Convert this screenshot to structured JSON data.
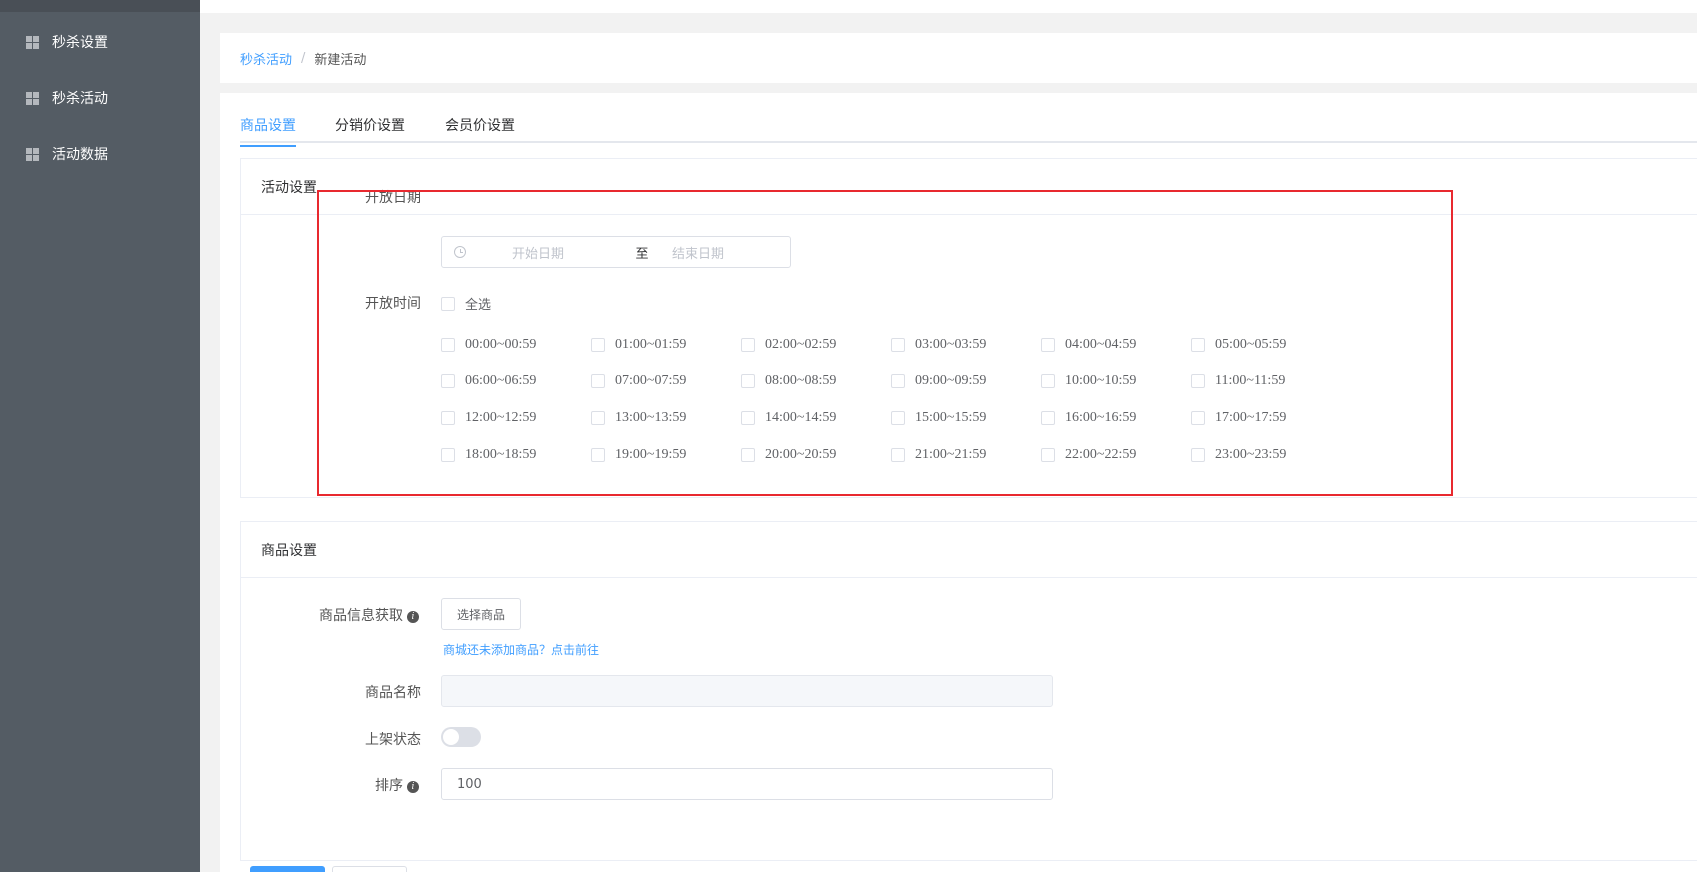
{
  "sidebar": {
    "items": [
      {
        "label": "秒杀设置",
        "icon": "grid-icon"
      },
      {
        "label": "秒杀活动",
        "icon": "grid-icon"
      },
      {
        "label": "活动数据",
        "icon": "grid-icon"
      }
    ]
  },
  "breadcrumb": {
    "parent": "秒杀活动",
    "separator": "/",
    "current": "新建活动"
  },
  "tabs": [
    {
      "label": "商品设置",
      "active": true
    },
    {
      "label": "分销价设置",
      "active": false
    },
    {
      "label": "会员价设置",
      "active": false
    }
  ],
  "activity": {
    "title": "活动设置",
    "date_label": "开放日期",
    "start_placeholder": "开始日期",
    "range_sep": "至",
    "end_placeholder": "结束日期",
    "time_label": "开放时间",
    "select_all": "全选",
    "slots": [
      "00:00~00:59",
      "01:00~01:59",
      "02:00~02:59",
      "03:00~03:59",
      "04:00~04:59",
      "05:00~05:59",
      "06:00~06:59",
      "07:00~07:59",
      "08:00~08:59",
      "09:00~09:59",
      "10:00~10:59",
      "11:00~11:59",
      "12:00~12:59",
      "13:00~13:59",
      "14:00~14:59",
      "15:00~15:59",
      "16:00~16:59",
      "17:00~17:59",
      "18:00~18:59",
      "19:00~19:59",
      "20:00~20:59",
      "21:00~21:59",
      "22:00~22:59",
      "23:00~23:59"
    ]
  },
  "goods": {
    "title": "商品设置",
    "info_label": "商品信息获取",
    "select_button": "选择商品",
    "hint_link": "商城还未添加商品？点击前往",
    "name_label": "商品名称",
    "name_value": "",
    "status_label": "上架状态",
    "status_on": false,
    "sort_label": "排序",
    "sort_value": "100"
  },
  "colors": {
    "accent": "#409eff",
    "sidebar": "#545c64",
    "highlight": "#e8292f"
  }
}
